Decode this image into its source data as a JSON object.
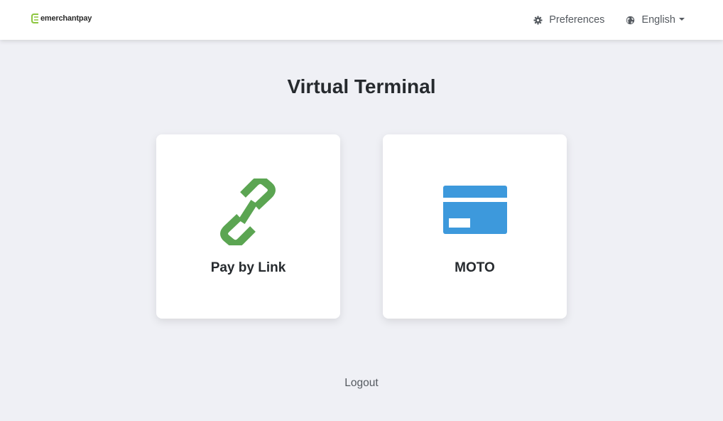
{
  "header": {
    "logo_text": "emerchantpay",
    "preferences_label": "Preferences",
    "language_label": "English"
  },
  "main": {
    "title": "Virtual Terminal",
    "cards": [
      {
        "label": "Pay by Link",
        "icon": "link-icon"
      },
      {
        "label": "MOTO",
        "icon": "credit-card-icon"
      }
    ],
    "logout_label": "Logout"
  },
  "colors": {
    "link_green": "#5ba552",
    "card_blue": "#3d99dc",
    "logo_green": "#8dc63f",
    "background": "#eff0f5"
  }
}
